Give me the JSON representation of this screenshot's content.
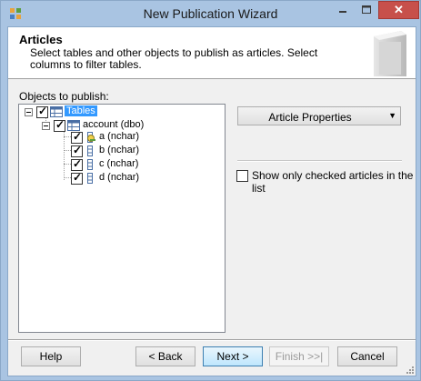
{
  "window": {
    "title": "New Publication Wizard",
    "close_glyph": "✕"
  },
  "header": {
    "title": "Articles",
    "description": "Select tables and other objects to publish as articles. Select columns to filter tables."
  },
  "objects_label": "Objects to publish:",
  "tree": {
    "root": {
      "label": "Tables",
      "checked": true,
      "icon": "table-icon"
    },
    "table": {
      "label": "account (dbo)",
      "checked": true,
      "icon": "table-icon"
    },
    "columns": [
      {
        "label": "a (nchar)",
        "checked": true,
        "icon": "key-column-icon"
      },
      {
        "label": "b (nchar)",
        "checked": true,
        "icon": "column-icon"
      },
      {
        "label": "c (nchar)",
        "checked": true,
        "icon": "column-icon"
      },
      {
        "label": "d (nchar)",
        "checked": true,
        "icon": "column-icon"
      }
    ]
  },
  "article_properties_label": "Article Properties",
  "show_only_checked_label": "Show only checked articles in the list",
  "buttons": {
    "help": "Help",
    "back": "< Back",
    "next": "Next >",
    "finish": "Finish >>|",
    "cancel": "Cancel"
  },
  "colors": {
    "title_bar": "#a9c4e2",
    "close_button": "#c7504b",
    "selection": "#3399ff"
  }
}
